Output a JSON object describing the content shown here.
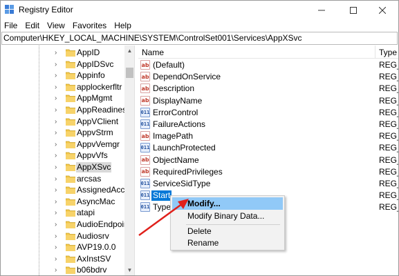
{
  "window": {
    "title": "Registry Editor"
  },
  "menubar": [
    "File",
    "Edit",
    "View",
    "Favorites",
    "Help"
  ],
  "address": "Computer\\HKEY_LOCAL_MACHINE\\SYSTEM\\ControlSet001\\Services\\AppXSvc",
  "tree": {
    "items": [
      {
        "label": "AppID"
      },
      {
        "label": "AppIDSvc"
      },
      {
        "label": "Appinfo"
      },
      {
        "label": "applockerfltr"
      },
      {
        "label": "AppMgmt"
      },
      {
        "label": "AppReadiness"
      },
      {
        "label": "AppVClient"
      },
      {
        "label": "AppvStrm"
      },
      {
        "label": "AppvVemgr"
      },
      {
        "label": "AppvVfs"
      },
      {
        "label": "AppXSvc",
        "selected": true
      },
      {
        "label": "arcsas"
      },
      {
        "label": "AssignedAcces"
      },
      {
        "label": "AsyncMac"
      },
      {
        "label": "atapi"
      },
      {
        "label": "AudioEndpoin"
      },
      {
        "label": "Audiosrv"
      },
      {
        "label": "AVP19.0.0"
      },
      {
        "label": "AxInstSV"
      },
      {
        "label": "b06bdrv"
      }
    ]
  },
  "list": {
    "columns": {
      "name": "Name",
      "type": "Type"
    },
    "rows": [
      {
        "name": "(Default)",
        "icon": "ab",
        "type": "REG_S"
      },
      {
        "name": "DependOnService",
        "icon": "ab",
        "type": "REG_M"
      },
      {
        "name": "Description",
        "icon": "ab",
        "type": "REG_S"
      },
      {
        "name": "DisplayName",
        "icon": "ab",
        "type": "REG_S"
      },
      {
        "name": "ErrorControl",
        "icon": "bin",
        "type": "REG_D"
      },
      {
        "name": "FailureActions",
        "icon": "bin",
        "type": "REG_B"
      },
      {
        "name": "ImagePath",
        "icon": "ab",
        "type": "REG_E"
      },
      {
        "name": "LaunchProtected",
        "icon": "bin",
        "type": "REG_D"
      },
      {
        "name": "ObjectName",
        "icon": "ab",
        "type": "REG_S"
      },
      {
        "name": "RequiredPrivileges",
        "icon": "ab",
        "type": "REG_M"
      },
      {
        "name": "ServiceSidType",
        "icon": "bin",
        "type": "REG_D"
      },
      {
        "name": "Start",
        "icon": "bin",
        "type": "REG_D",
        "selected": true
      },
      {
        "name": "Type",
        "icon": "bin",
        "type": "REG_D"
      }
    ]
  },
  "icons": {
    "ab": "ab",
    "bin": "011"
  },
  "context_menu": {
    "items": [
      {
        "label": "Modify...",
        "highlighted": true
      },
      {
        "label": "Modify Binary Data..."
      },
      {
        "label": "Delete"
      },
      {
        "label": "Rename"
      }
    ]
  },
  "colors": {
    "selection": "#0078d7",
    "menu_highlight": "#91c9f7",
    "arrow": "#e0201b",
    "folder": "#f3c74b"
  }
}
